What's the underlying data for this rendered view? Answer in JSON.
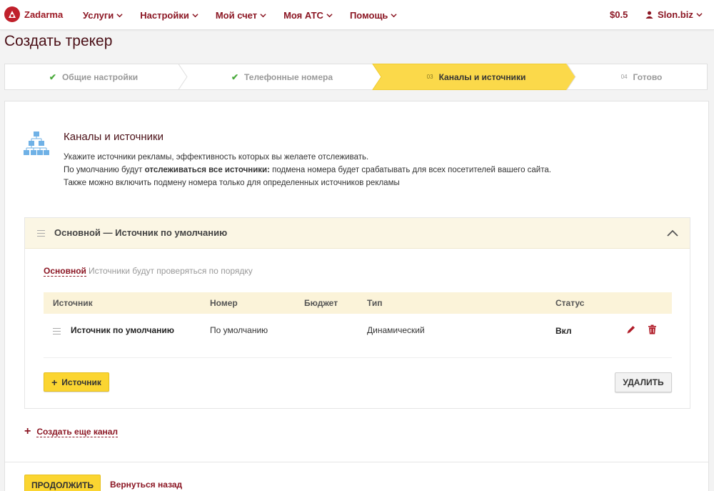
{
  "brand": {
    "name": "Zadarma"
  },
  "nav": {
    "items": [
      "Услуги",
      "Настройки",
      "Мой счет",
      "Моя АТС",
      "Помощь"
    ]
  },
  "header": {
    "balance": "$0.5",
    "user": "Slon.biz"
  },
  "page": {
    "title": "Создать трекер"
  },
  "steps": [
    {
      "label": "Общие настройки",
      "state": "done"
    },
    {
      "label": "Телефонные номера",
      "state": "done"
    },
    {
      "number": "03",
      "label": "Каналы и источники",
      "state": "active"
    },
    {
      "number": "04",
      "label": "Готово",
      "state": "pending"
    }
  ],
  "section": {
    "title": "Каналы и источники",
    "line1": "Укажите источники рекламы, эффективность которых вы желаете отслеживать.",
    "line2_pre": "По умолчанию будут ",
    "line2_bold": "отслеживаться все источники:",
    "line2_post": " подмена номера будет срабатывать для всех посетителей вашего сайта.",
    "line3": "Также можно включить подмену номера только для определенных источников рекламы"
  },
  "channel": {
    "title": "Основной — Источник по умолчанию",
    "tab_label": "Основной",
    "tab_hint": "Источники будут проверяться по порядку",
    "columns": [
      "Источник",
      "Номер",
      "Бюджет",
      "Тип",
      "Статус"
    ],
    "rows": [
      {
        "source": "Источник по умолчанию",
        "number": "По умолчанию",
        "budget": "",
        "type": "Динамический",
        "status": "Вкл"
      }
    ],
    "add_source_label": "Источник",
    "delete_label": "УДАЛИТЬ"
  },
  "actions": {
    "add_channel_label": "Создать еще канал",
    "continue_label": "ПРОДОЛЖИТЬ",
    "back_label": "Вернуться назад"
  },
  "colors": {
    "brand": "#c0202b",
    "link": "#8b1623",
    "accent_yellow": "#fbd531",
    "step_active": "#fbd94a",
    "done_check": "#4aaa3c"
  }
}
